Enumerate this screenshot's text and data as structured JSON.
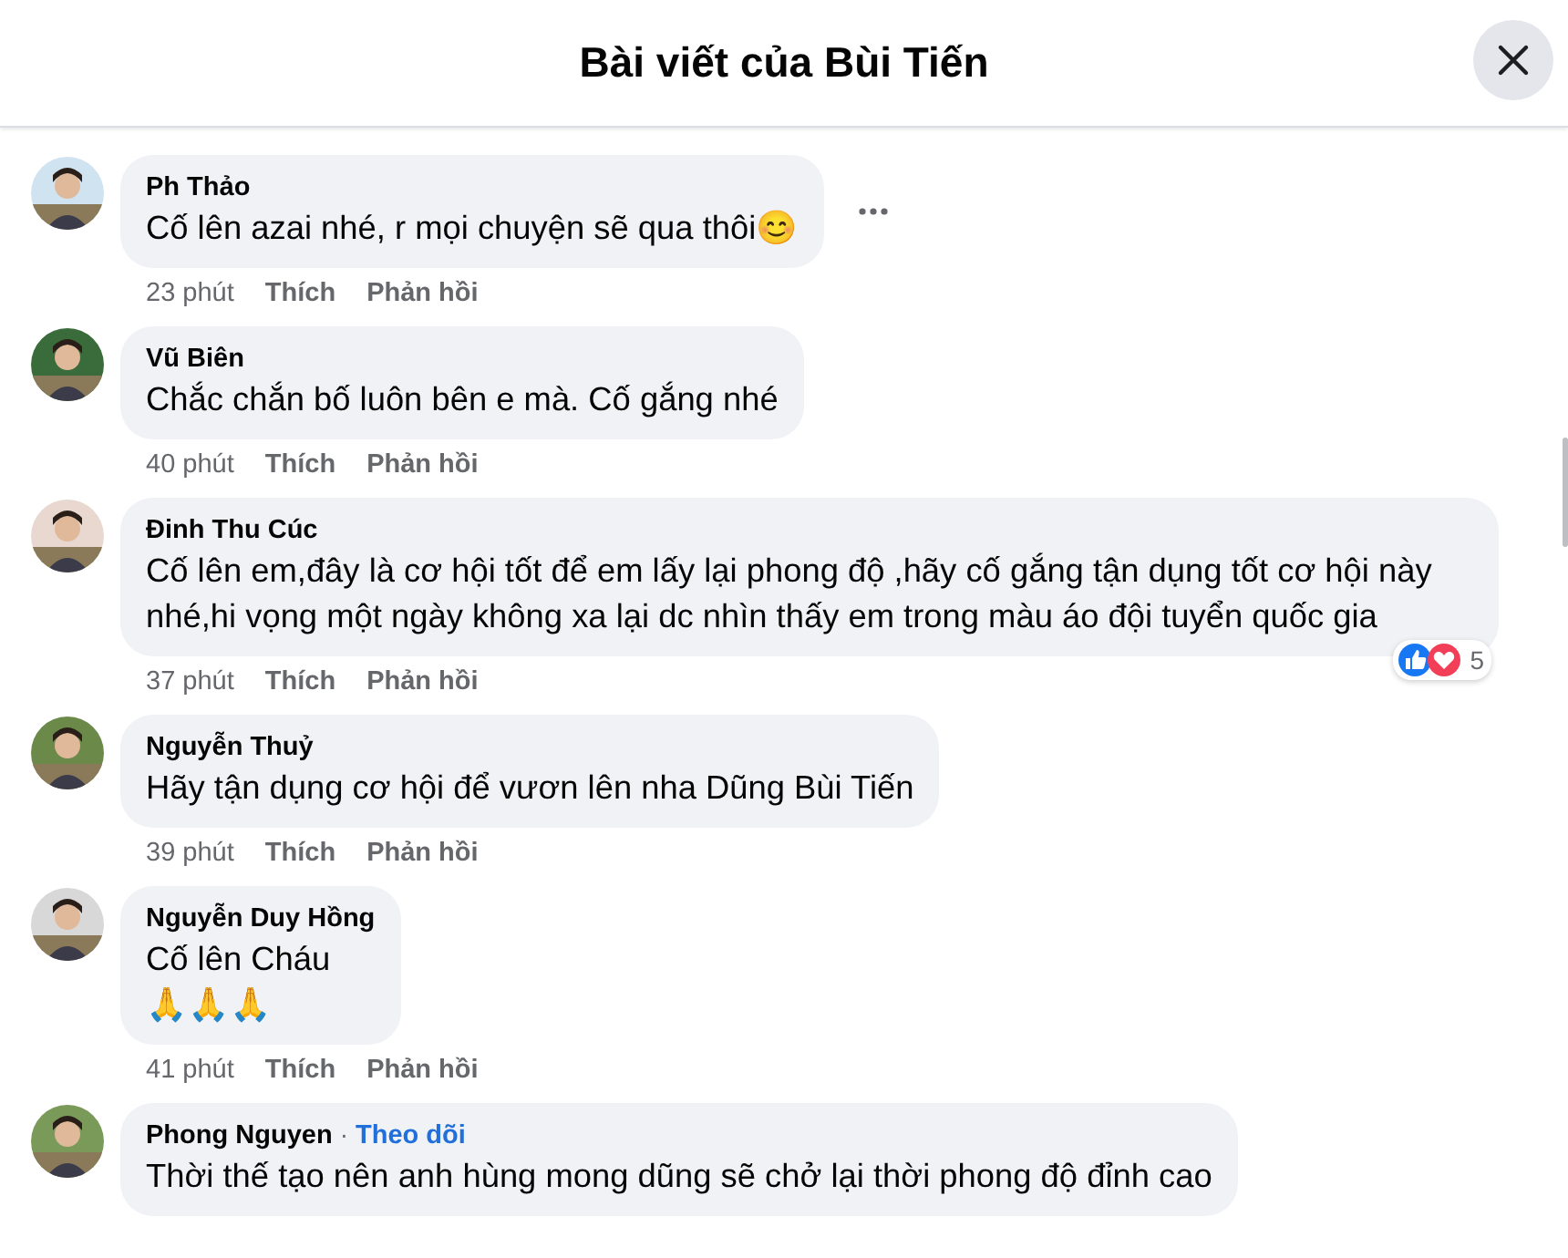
{
  "header": {
    "title": "Bài viết của Bùi Tiến"
  },
  "comments": [
    {
      "author": "Ph Thảo",
      "text": "Cố lên azai nhé, r mọi chuyện sẽ qua thôi😊",
      "time": "23 phút",
      "like": "Thích",
      "reply": "Phản hồi",
      "menu_visible": true
    },
    {
      "author": "Vũ Biên",
      "text": "Chắc chắn bố luôn bên e mà. Cố gắng nhé",
      "time": "40 phút",
      "like": "Thích",
      "reply": "Phản hồi",
      "menu_visible": false
    },
    {
      "author": "Đinh Thu Cúc",
      "text": "Cố lên em,đây là cơ hội tốt để em lấy lại phong độ ,hãy cố gắng tận dụng tốt cơ hội này nhé,hi vọng một ngày không xa lại dc nhìn thấy em trong màu áo đội tuyển quốc gia",
      "time": "37 phút",
      "like": "Thích",
      "reply": "Phản hồi",
      "menu_visible": false,
      "reaction_count": "5"
    },
    {
      "author": "Nguyễn Thuỷ",
      "text": "Hãy tận dụng cơ hội để vươn lên nha Dũng Bùi Tiến",
      "time": "39 phút",
      "like": "Thích",
      "reply": "Phản hồi",
      "menu_visible": false
    },
    {
      "author": "Nguyễn Duy Hồng",
      "text": "Cố lên Cháu",
      "extra": "🙏🙏🙏",
      "time": "41 phút",
      "like": "Thích",
      "reply": "Phản hồi",
      "menu_visible": false
    },
    {
      "author": "Phong Nguyen",
      "follow_separator": "·",
      "follow": "Theo dõi",
      "text": "Thời thế tạo nên anh hùng mong dũng sẽ chở lại thời phong độ đỉnh cao",
      "menu_visible": false
    }
  ]
}
